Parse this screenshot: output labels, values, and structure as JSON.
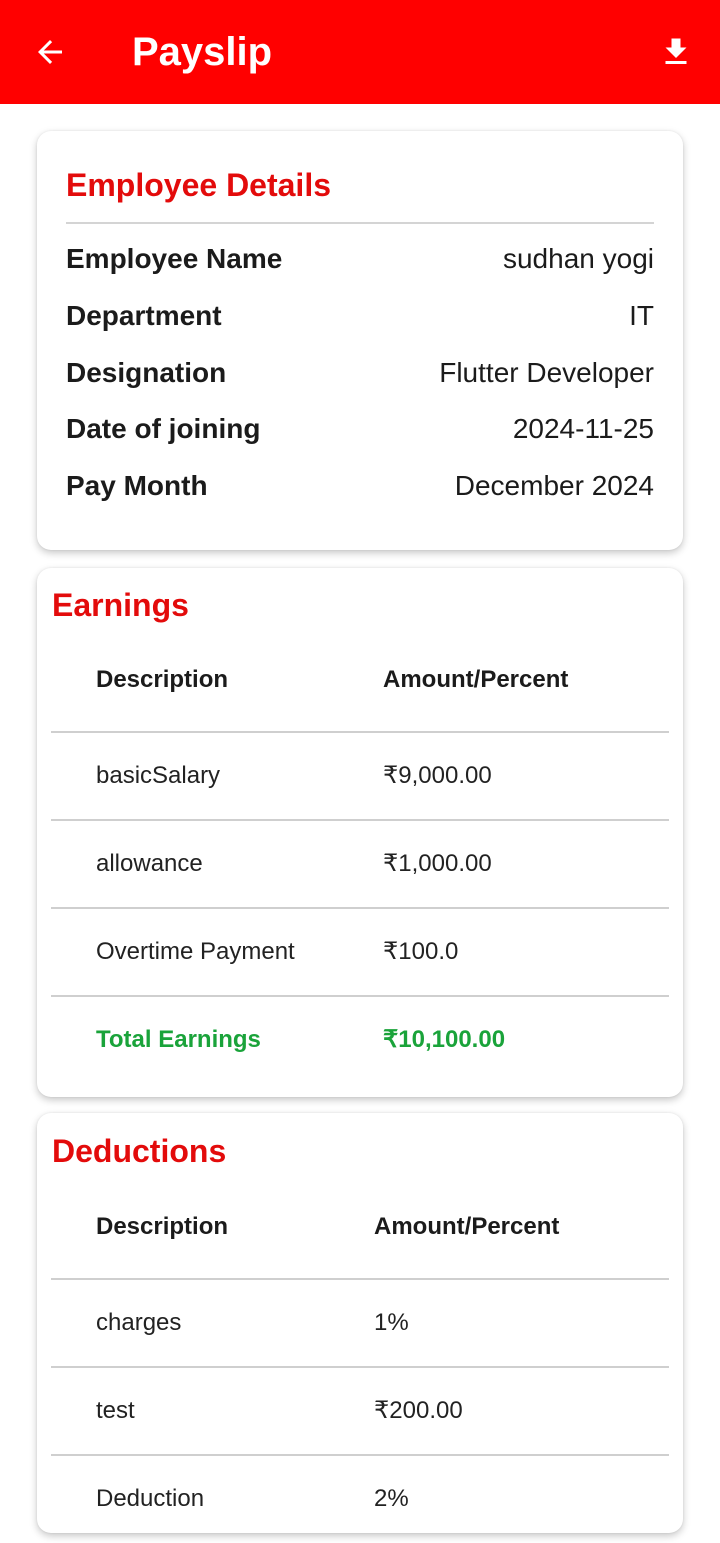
{
  "app_bar": {
    "title": "Payslip",
    "back_icon": "arrow-left-icon",
    "download_icon": "download-icon",
    "color": "#ff0000"
  },
  "employee_details": {
    "title": "Employee Details",
    "rows": [
      {
        "label": "Employee Name",
        "value": "sudhan yogi"
      },
      {
        "label": "Department",
        "value": "IT"
      },
      {
        "label": "Designation",
        "value": "Flutter Developer"
      },
      {
        "label": "Date of joining",
        "value": "2024-11-25"
      },
      {
        "label": "Pay Month",
        "value": "December 2024"
      }
    ]
  },
  "earnings": {
    "title": "Earnings",
    "headers": {
      "description": "Description",
      "amount": "Amount/Percent"
    },
    "rows": [
      {
        "description": "basicSalary",
        "amount": "₹9,000.00"
      },
      {
        "description": "allowance",
        "amount": "₹1,000.00"
      },
      {
        "description": "Overtime Payment",
        "amount": "₹100.0"
      }
    ],
    "total": {
      "description": "Total Earnings",
      "amount": "₹10,100.00"
    },
    "total_color": "#1aa33a"
  },
  "deductions": {
    "title": "Deductions",
    "headers": {
      "description": "Description",
      "amount": "Amount/Percent"
    },
    "rows": [
      {
        "description": "charges",
        "amount": "1%"
      },
      {
        "description": "test",
        "amount": "₹200.00"
      },
      {
        "description": "Deduction",
        "amount": "2%"
      }
    ]
  },
  "colors": {
    "accent_red": "#e30b0b",
    "total_green": "#1aa33a"
  }
}
